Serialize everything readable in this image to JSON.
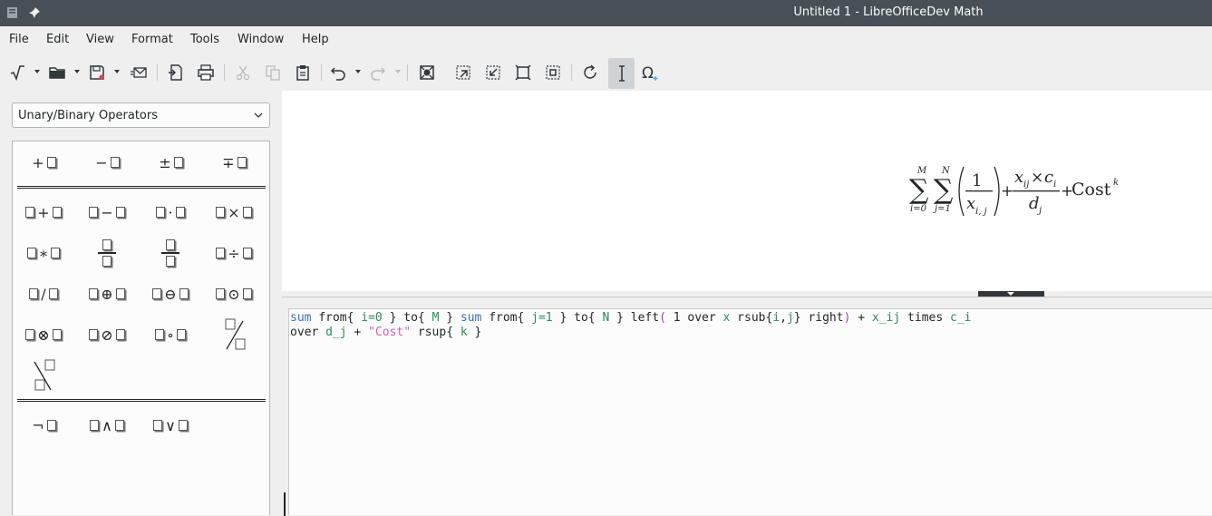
{
  "window": {
    "title": "Untitled 1 - LibreOfficeDev Math"
  },
  "menubar": {
    "items": [
      "File",
      "Edit",
      "View",
      "Format",
      "Tools",
      "Window",
      "Help"
    ]
  },
  "toolbar": {
    "buttons": [
      {
        "name": "formula-cursor",
        "icon": "sqrt-icon"
      },
      {
        "name": "open",
        "icon": "folder-icon"
      },
      {
        "name": "save",
        "icon": "save-icon"
      },
      {
        "name": "email",
        "icon": "email-icon"
      },
      {
        "name": "export-pdf",
        "icon": "pdf-icon"
      },
      {
        "name": "print",
        "icon": "print-icon"
      },
      {
        "name": "cut",
        "icon": "cut-icon"
      },
      {
        "name": "copy",
        "icon": "copy-icon"
      },
      {
        "name": "paste",
        "icon": "paste-icon"
      },
      {
        "name": "undo",
        "icon": "undo-icon"
      },
      {
        "name": "redo",
        "icon": "redo-icon"
      },
      {
        "name": "zoom",
        "icon": "zoom-icon"
      },
      {
        "name": "zoom-in",
        "icon": "zoom-in-icon"
      },
      {
        "name": "zoom-out",
        "icon": "zoom-out-icon"
      },
      {
        "name": "show-all",
        "icon": "show-all-icon"
      },
      {
        "name": "zoom-fit",
        "icon": "zoom-fit-icon"
      },
      {
        "name": "update",
        "icon": "refresh-icon"
      },
      {
        "name": "formula-cursor-toggle",
        "icon": "text-cursor-icon"
      },
      {
        "name": "symbols",
        "icon": "omega-icon"
      }
    ]
  },
  "sidebar": {
    "category": "Unary/Binary Operators",
    "elements": {
      "unary": [
        "+",
        "−",
        "±",
        "∓"
      ],
      "binary": [
        "+",
        "−",
        "·",
        "×",
        "∗",
        "÷",
        "/",
        "⊕",
        "⊖",
        "⊙",
        "⊗",
        "⊘",
        "∘"
      ],
      "logic": [
        "¬",
        "∧",
        "∨"
      ]
    }
  },
  "preview": {
    "formula_text": {
      "sum1_upper": "M",
      "sum1_lower": "i=0",
      "sum2_upper": "N",
      "sum2_lower": "j=1",
      "frac1_num": "1",
      "frac1_den": "x",
      "frac1_den_sub": "i, j",
      "frac2_num_a": "x",
      "frac2_num_a_sub": "ij",
      "times": "×",
      "frac2_num_b": "c",
      "frac2_num_b_sub": "i",
      "frac2_den": "d",
      "frac2_den_sub": "j",
      "plus": "+",
      "cost": "Cost",
      "cost_sup": "k"
    }
  },
  "editor": {
    "tokens": {
      "sum": "sum",
      "from": "from{",
      "i_eq_0": "i=0",
      "close": "}",
      "to": "to{",
      "M": "M",
      "j_eq_1": "j=1",
      "N": "N",
      "left": "left",
      "lparen": "(",
      "one": "1",
      "over": "over",
      "x": "x",
      "rsub": "rsub{",
      "i": "i",
      "comma": ",",
      "j": "j",
      "right": "right",
      "rparen": ")",
      "plus": "+",
      "x_ij": "x_ij",
      "times": "times",
      "c_i": "c_i",
      "d_j": "d_j",
      "cost_str": "\"Cost\"",
      "rsup": "rsup{",
      "k": "k"
    }
  }
}
